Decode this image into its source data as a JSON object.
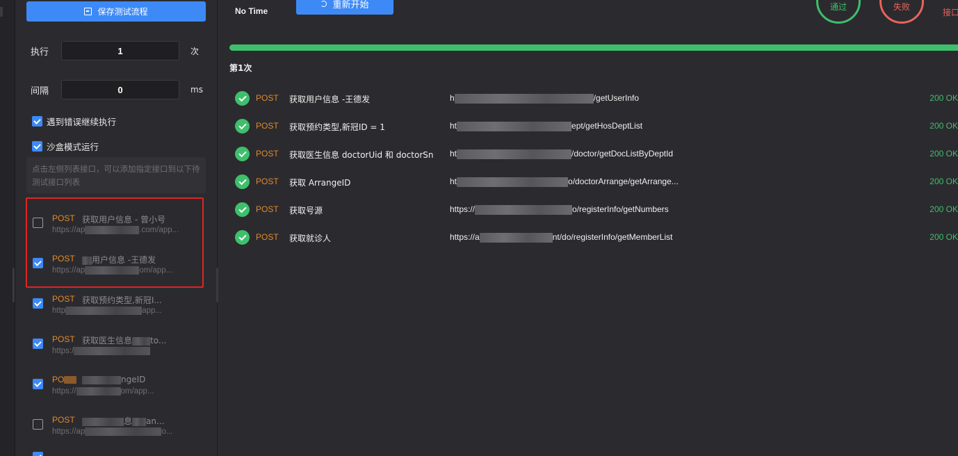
{
  "sidebar": {
    "save_label": "保存测试流程",
    "exec": {
      "label": "执行",
      "value": "1",
      "unit": "次"
    },
    "interval": {
      "label": "间隔",
      "value": "0",
      "unit": "ms"
    },
    "opt_continue": {
      "label": "遇到错误继续执行",
      "checked": true
    },
    "opt_sandbox": {
      "label": "沙盒模式运行",
      "checked": true
    },
    "hint": "点击左侧列表接口，可以添加指定接口到以下待测试接口列表",
    "items": [
      {
        "method": "POST",
        "name": "获取用户信息 - 曾小号",
        "url_start": "https://ap",
        "url_end": ".com/app...",
        "checked": false
      },
      {
        "method": "POST",
        "name": "用户信息 -王德发",
        "url_start": "https://ap",
        "url_end": "om/app...",
        "checked": true
      },
      {
        "method": "POST",
        "name": "获取预约类型,新冠I...",
        "url_start": "http",
        "url_end": "app...",
        "checked": true
      },
      {
        "method": "POST",
        "name": "获取医生信息",
        "name_end": "to...",
        "url_start": "https:/",
        "url_end": "",
        "checked": true
      },
      {
        "method": "PO",
        "name": "ngeID",
        "url_start": "https://",
        "url_end": "om/app...",
        "checked": true
      },
      {
        "method": "POST",
        "name": "息",
        "name_end": "an...",
        "url_start": "https://ap",
        "url_end": "o...",
        "checked": false
      }
    ]
  },
  "main": {
    "time_text": "No Time",
    "restart_label": "重新开始",
    "pass_label": "通过",
    "fail_label": "失败",
    "iface_label": "接口",
    "round_label": "第1次",
    "progress": 1.0,
    "results": [
      {
        "method": "POST",
        "name": "获取用户信息 -王德发",
        "url_start": "h",
        "url_end": "/getUserInfo",
        "status": "200 OK"
      },
      {
        "method": "POST",
        "name": "获取预约类型,新冠ID = 1",
        "url_start": "ht",
        "url_end": "ept/getHosDeptList",
        "status": "200 OK"
      },
      {
        "method": "POST",
        "name": "获取医生信息 doctorUid 和 doctorSn",
        "url_start": "ht",
        "url_end": "/doctor/getDocListByDeptId",
        "status": "200 OK"
      },
      {
        "method": "POST",
        "name": "获取 ArrangeID",
        "url_start": "ht",
        "url_end": "o/doctorArrange/getArrange...",
        "status": "200 OK"
      },
      {
        "method": "POST",
        "name": "获取号源",
        "url_start": "https://",
        "url_end": "o/registerInfo/getNumbers",
        "status": "200 OK"
      },
      {
        "method": "POST",
        "name": "获取就诊人",
        "url_start": "https://a",
        "url_end": "nt/do/registerInfo/getMemberList",
        "status": "200 OK"
      }
    ]
  },
  "colors": {
    "accent": "#3d8af7",
    "success": "#3fbf6c",
    "danger": "#e8645a",
    "method": "#e08a2e",
    "highlight_frame": "#e02424"
  }
}
